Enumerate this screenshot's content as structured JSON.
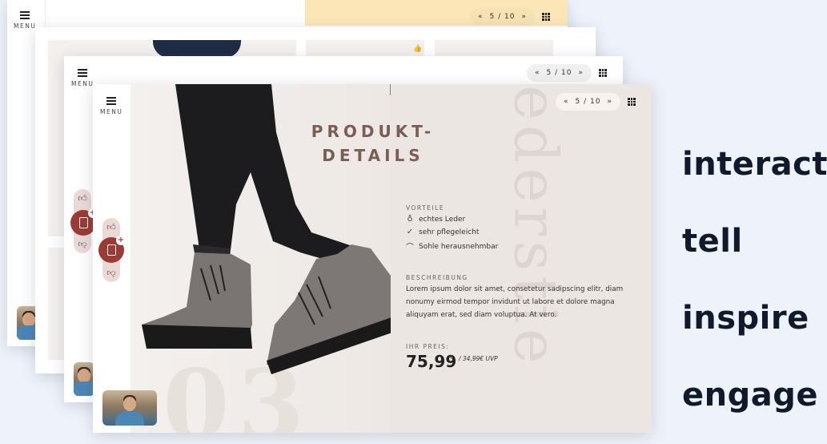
{
  "menu": {
    "label": "MENU",
    "icon": "hamburger-icon"
  },
  "pager": {
    "text": "5 / 10",
    "prev_icon": "double-chevron-left-icon",
    "next_icon": "double-chevron-right-icon",
    "grid_icon": "grid-icon"
  },
  "product": {
    "title_line1": "PRODUKT-",
    "title_line2": "DETAILS",
    "advantages_label": "VORTEILE",
    "advantages": [
      {
        "icon": "leather-icon",
        "glyph": "♁",
        "text": "echtes Leder"
      },
      {
        "icon": "check-icon",
        "glyph": "✓",
        "text": "sehr pflegeleicht"
      },
      {
        "icon": "insole-icon",
        "glyph": "⌒",
        "text": "Sohle herausnehmbar"
      }
    ],
    "description_label": "BESCHREIBUNG",
    "description": "Lorem ipsum dolor sit amet, consetetur sadipscing elitr, diam nonumy eirmod tempor invidunt ut labore et dolore magna aliquyam erat, sed diam voluptua. At vero.",
    "price_label": "IHR PREIS:",
    "price": "75,99",
    "currency": "€",
    "uvp": "/ 34,99€ UVP",
    "background_number": "03",
    "background_word": "lederstie"
  },
  "taglines": [
    "interact",
    "tell",
    "inspire",
    "engage"
  ],
  "colors": {
    "accent": "#9c3b35",
    "background": "#eef3fb",
    "title": "#7a5e55",
    "back_card_header": "#fce6b8"
  }
}
